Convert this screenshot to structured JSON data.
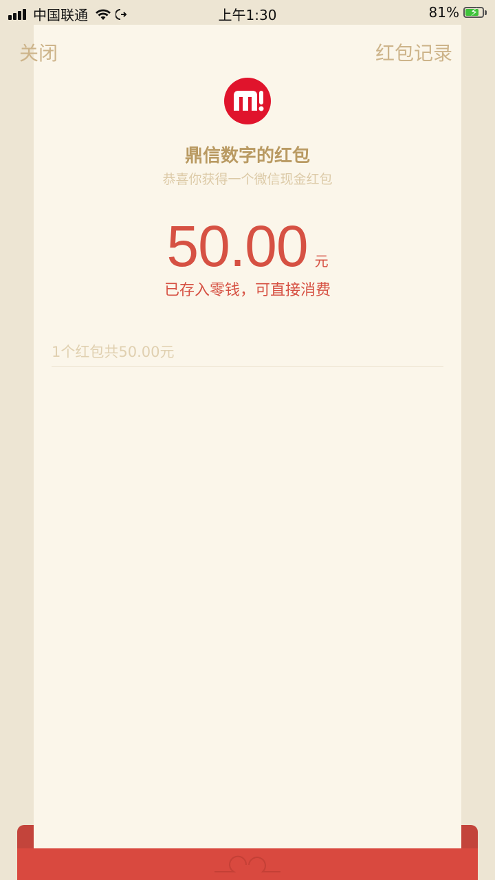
{
  "status_bar": {
    "carrier": "中国联通",
    "time": "上午1:30",
    "battery_percent": "81%",
    "battery_level": 0.81,
    "signal_bars": 4,
    "icons": [
      "signal-icon",
      "wifi-icon",
      "call-forward-icon",
      "battery-charging-icon"
    ]
  },
  "nav": {
    "close_label": "关闭",
    "records_label": "红包记录"
  },
  "packet": {
    "logo_icon": "m-logo-icon",
    "sender_title": "鼎信数字的红包",
    "subtitle": "恭喜你获得一个微信现金红包",
    "amount": "50.00",
    "unit": "元",
    "stored_note": "已存入零钱，可直接消费",
    "summary": "1个红包共50.00元"
  },
  "colors": {
    "background": "#ede5d3",
    "card": "#fbf6ea",
    "gold_text": "#b99a62",
    "red_text": "#d65143",
    "envelope_red": "#d9493f",
    "logo_red": "#e0142c",
    "battery_green": "#3fc33b"
  }
}
